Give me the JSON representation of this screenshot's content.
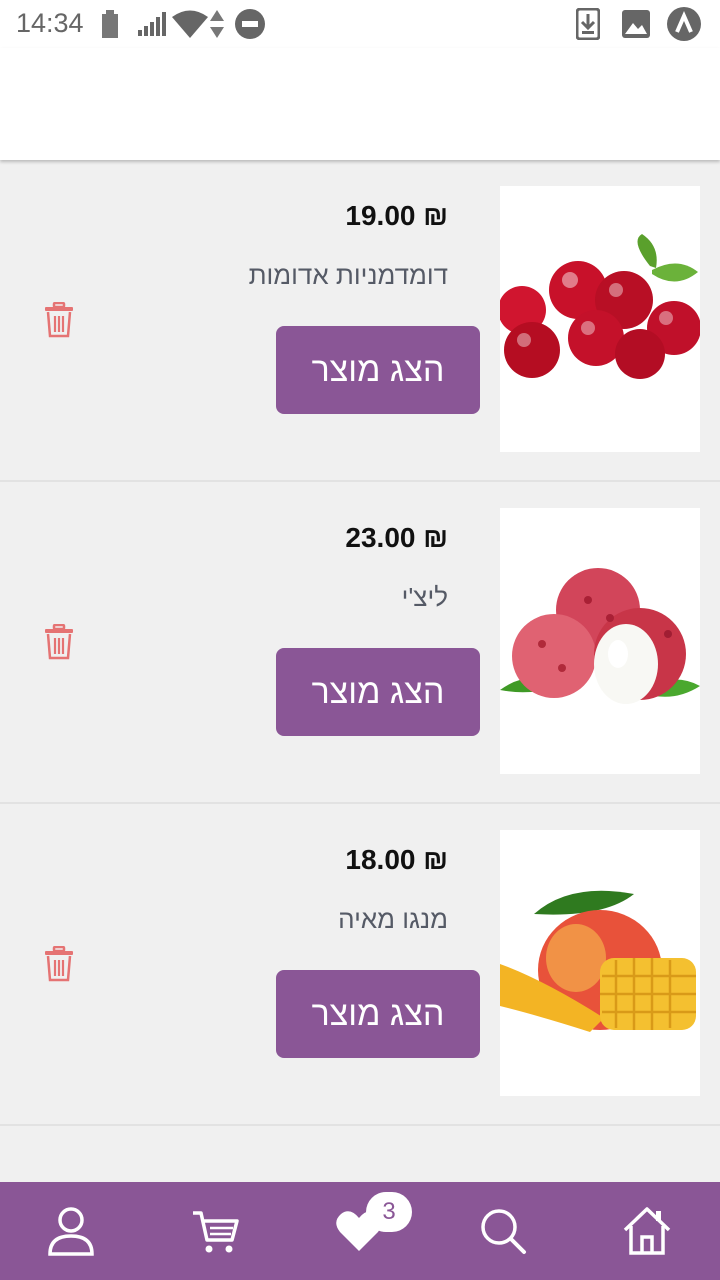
{
  "status_bar": {
    "time": "14:34",
    "icons": [
      "battery-icon",
      "signal-icon",
      "wifi-icon",
      "data-arrows-icon",
      "do-not-disturb-icon",
      "download-icon",
      "image-icon",
      "app-notification-icon"
    ]
  },
  "products": [
    {
      "price": "₪ 19.00",
      "name": "דומדמניות אדומות",
      "button_label": "הצג מוצר",
      "image": "cranberries"
    },
    {
      "price": "₪ 23.00",
      "name": "ליצ'י",
      "button_label": "הצג מוצר",
      "image": "lychee"
    },
    {
      "price": "₪ 18.00",
      "name": "מנגו מאיה",
      "button_label": "הצג מוצר",
      "image": "mango"
    }
  ],
  "bottom_nav": {
    "items": [
      "profile-icon",
      "cart-icon",
      "favorites-icon",
      "search-icon",
      "home-icon"
    ],
    "favorites_count": "3"
  },
  "colors": {
    "accent": "#8a5696",
    "delete": "#e57373",
    "background": "#f0f0f0"
  }
}
